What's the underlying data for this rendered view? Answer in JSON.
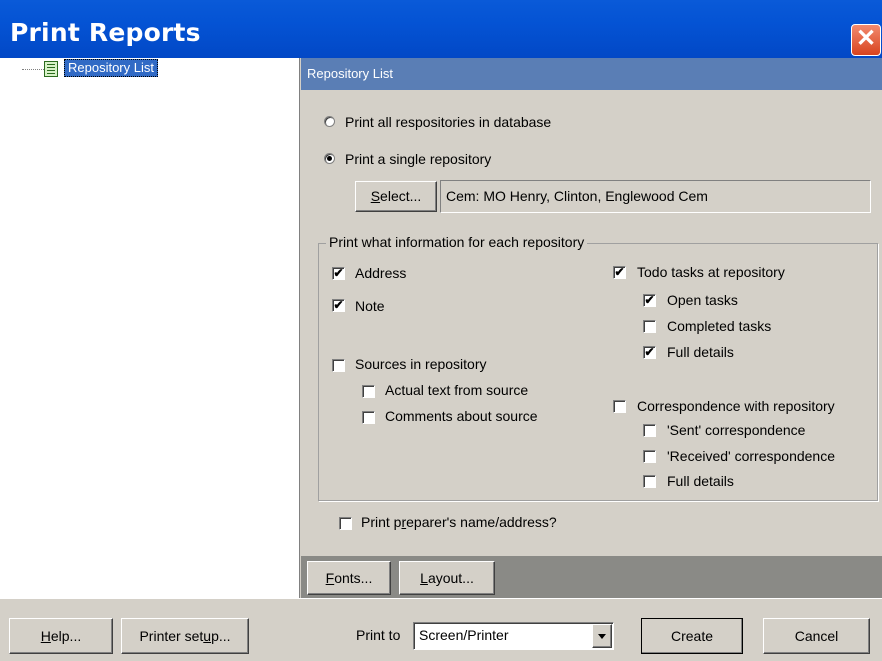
{
  "window": {
    "title": "Print Reports",
    "close_glyph": "✕"
  },
  "tree": {
    "items": [
      {
        "label": "Repository List",
        "icon": "report-icon"
      }
    ]
  },
  "panel": {
    "header": "Repository List",
    "scope": {
      "option_all": "Print all respositories in database",
      "option_single": "Print a single repository",
      "selected": "single"
    },
    "select_button": {
      "prefix": "",
      "accel": "S",
      "rest": "elect..."
    },
    "selected_repository": "Cem:  MO Henry, Clinton, Englewood Cem",
    "group_title": "Print what information for each repository",
    "checkboxes": {
      "address": {
        "label": "Address",
        "checked": true
      },
      "note": {
        "label": "Note",
        "checked": true
      },
      "sources": {
        "label": "Sources in repository",
        "checked": false
      },
      "actual_text": {
        "label": "Actual text from source",
        "checked": false
      },
      "comments": {
        "label": "Comments about source",
        "checked": false
      },
      "todo": {
        "label": "Todo tasks at repository",
        "checked": true
      },
      "open_tasks": {
        "label": "Open tasks",
        "checked": true
      },
      "completed_tasks": {
        "label": "Completed tasks",
        "checked": false
      },
      "todo_full": {
        "label": "Full details",
        "checked": true
      },
      "correspondence": {
        "label": "Correspondence with repository",
        "checked": false
      },
      "sent": {
        "label": "'Sent' correspondence",
        "checked": false
      },
      "received": {
        "label": "'Received' correspondence",
        "checked": false
      },
      "corr_full": {
        "label": "Full details",
        "checked": false
      }
    },
    "preparer": {
      "pre": "Print p",
      "accel": "r",
      "post": "eparer's name/address?",
      "checked": false
    },
    "fonts_button": {
      "accel": "F",
      "rest": "onts..."
    },
    "layout_button": {
      "accel": "L",
      "rest": "ayout..."
    }
  },
  "footer": {
    "help_button": {
      "accel": "H",
      "rest": "elp..."
    },
    "printer_setup_button": {
      "pre": "Printer set",
      "accel": "u",
      "post": "p..."
    },
    "print_to_label": "Print to",
    "print_to_value": "Screen/Printer",
    "create_button": "Create",
    "cancel_button": "Cancel"
  }
}
